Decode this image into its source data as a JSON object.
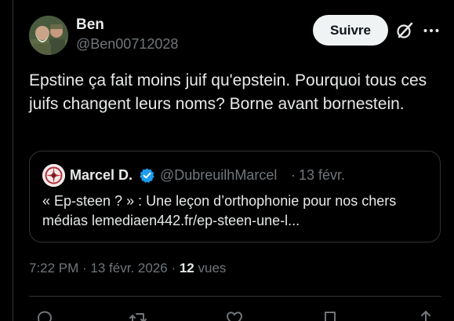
{
  "author": {
    "name": "Ben",
    "handle": "@Ben00712028"
  },
  "follow_label": "Suivre",
  "tweet_text": "Epstine ça fait moins juif qu'epstein. Pourquoi tous ces juifs changent leurs noms? Borne avant bornestein.",
  "quoted": {
    "name": "Marcel D.",
    "handle": "@DubreuilhMarcel",
    "separator": "·",
    "date": "13 févr.",
    "text": "« Ep-steen ? » : Une leçon d’orthophonie pour nos chers médias lemediaen442.fr/ep-steen-une-l..."
  },
  "meta": {
    "time": "7:22 PM",
    "sep1": " · ",
    "date": "13 févr. 2026",
    "sep2": " · ",
    "views_count": "12",
    "views_label": " vues"
  },
  "icons": {
    "grok": "grok-icon",
    "more": "more-icon",
    "verified": "verified-badge-icon",
    "reply": "reply-icon",
    "retweet": "retweet-icon",
    "like": "like-icon",
    "bookmark": "bookmark-icon",
    "share": "share-icon"
  },
  "colors": {
    "background": "#000000",
    "text": "#e7e9ea",
    "secondary": "#71767b",
    "border": "#2f3336",
    "verified": "#1d9bf0",
    "follow_bg": "#eff3f4"
  }
}
